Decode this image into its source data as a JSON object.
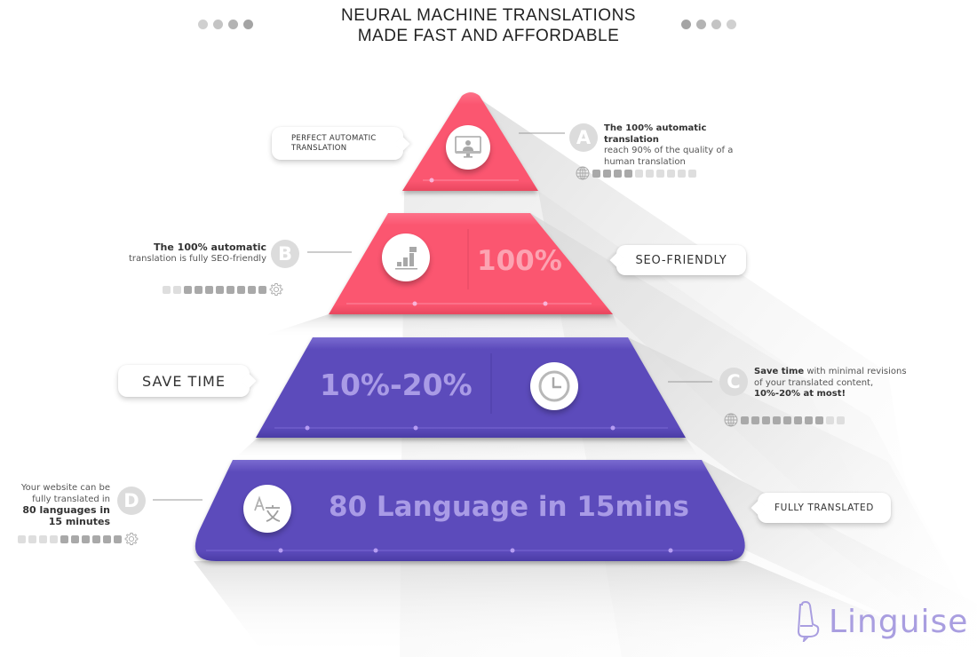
{
  "title": {
    "line1": "NEURAL MACHINE TRANSLATIONS",
    "line2": "MADE FAST AND AFFORDABLE",
    "left_dots": [
      "#d0d0d0",
      "#c4c4c4",
      "#b4b4b4",
      "#a4a4a4"
    ],
    "right_dots": [
      "#a4a4a4",
      "#b4b4b4",
      "#c4c4c4",
      "#d0d0d0"
    ]
  },
  "colors": {
    "coral": "#fb5670",
    "coral_text": "#fca3b2",
    "purple": "#5c4bbb",
    "purple_text": "#a99be6",
    "logo": "#a99ee0",
    "badge": "#dcdcdc",
    "dot_dark": "#a9a9a9",
    "dot_light": "#dedede"
  },
  "tiers": [
    {
      "id": "A",
      "icon": "monitor-user-icon",
      "callout": "PERFECT AUTOMATIC\nTRANSLATION",
      "callout_line1": "PERFECT AUTOMATIC",
      "callout_line2": "TRANSLATION",
      "badge": "A",
      "desc_bold": "The 100% automatic translation",
      "desc_rest_line1": "reach 90% of the quality of a",
      "desc_rest_line2": "human translation",
      "progress_icon": "globe-icon",
      "progress_filled": 4,
      "progress_total": 10
    },
    {
      "id": "B",
      "icon": "bar-chart-icon",
      "big_text": "100%",
      "callout": "SEO-FRIENDLY",
      "badge": "B",
      "desc_bold": "The 100% automatic",
      "desc_rest_line1": "translation is fully SEO-friendly",
      "progress_icon": "gear-icon",
      "progress_filled": 8,
      "progress_total": 10
    },
    {
      "id": "C",
      "icon": "clock-icon",
      "big_text": "10%-20%",
      "callout": "SAVE TIME",
      "badge": "C",
      "desc_bold": "Save time",
      "desc_rest_line1": " with minimal revisions",
      "desc_rest_line2": "of your translated content,",
      "desc_bold2": "10%-20% at most!",
      "progress_icon": "globe-icon",
      "progress_filled": 8,
      "progress_total": 10
    },
    {
      "id": "D",
      "icon": "translate-icon",
      "big_text": "80 Language in 15mins",
      "callout": "FULLY TRANSLATED",
      "badge": "D",
      "desc_line1": "Your website can be",
      "desc_line2": "fully translated in",
      "desc_bold_line3": "80 languages in",
      "desc_bold_line4": "15 minutes",
      "progress_icon": "gear-icon",
      "progress_filled": 6,
      "progress_total": 10
    }
  ],
  "logo": {
    "text": "Linguise",
    "icon": "linguise-logo-icon"
  }
}
